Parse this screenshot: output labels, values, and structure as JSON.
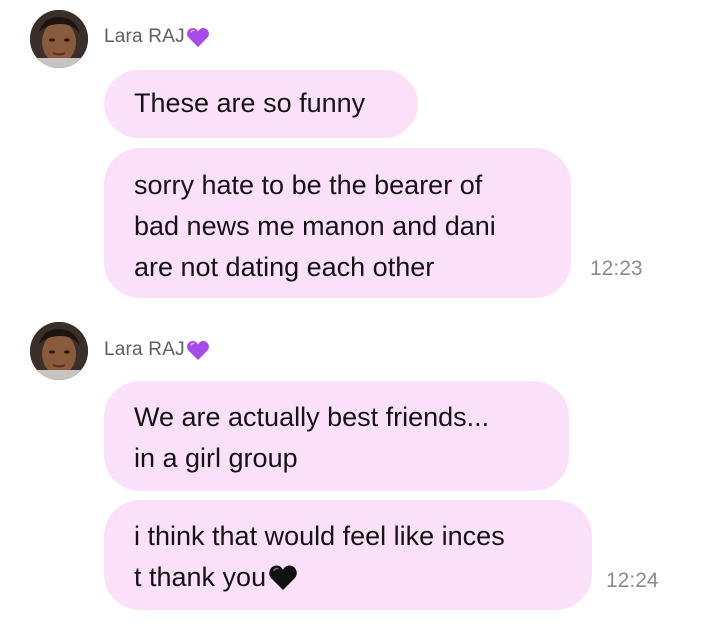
{
  "conversation": {
    "groups": [
      {
        "sender": "Lara RAJ",
        "messages": [
          {
            "lines": [
              "These are so funny"
            ]
          },
          {
            "lines": [
              "sorry hate to be the bearer of",
              "bad news me manon and dani",
              "are not dating each other"
            ]
          }
        ],
        "time": "12:23"
      },
      {
        "sender": "Lara RAJ",
        "messages": [
          {
            "lines": [
              "We are actually best friends...",
              "in a girl group"
            ]
          },
          {
            "lines": [
              "i think that would feel like inces",
              "t thank you"
            ]
          }
        ],
        "time": "12:24"
      }
    ]
  },
  "colors": {
    "bubble": "#fbe0fa",
    "sender_text": "#5f5f5f",
    "timestamp": "#8c8c8c",
    "purple_heart": "#a64be8",
    "black_heart": "#111111"
  },
  "icons": {
    "sender_badge": "purple-heart-icon",
    "message_emoji": "black-heart-icon"
  }
}
